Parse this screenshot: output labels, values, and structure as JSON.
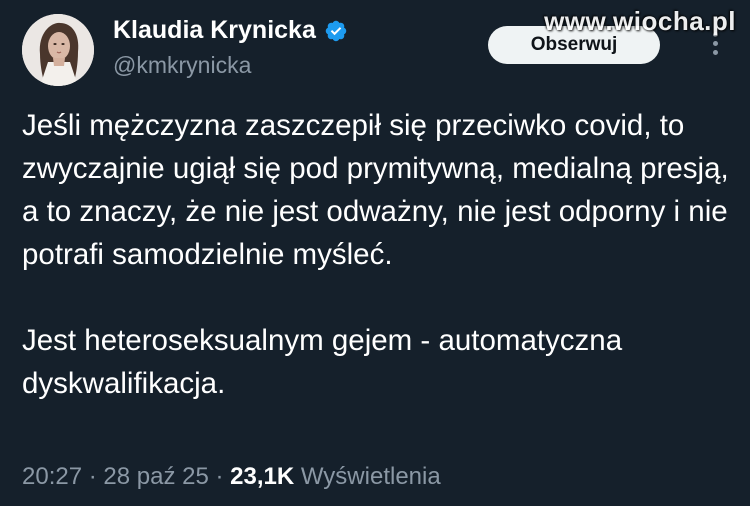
{
  "author": {
    "name": "Klaudia Krynicka",
    "handle": "@kmkrynicka",
    "verified_icon": "verified-badge-icon",
    "verified_color": "#1d9bf0"
  },
  "follow_button": {
    "label": "Obserwuj"
  },
  "more_icon": "more-options-icon",
  "watermark": "www.wiocha.pl",
  "tweet": {
    "paragraphs": [
      "Jeśli mężczyzna zaszczepił się przeciwko covid, to zwyczajnie ugiął się pod prymitywną, medialną presją, a to znaczy, że nie jest odważny, nie jest odporny i nie potrafi samodzielnie myśleć.",
      "Jest heteroseksualnym gejem - automatyczna dyskwalifikacja."
    ]
  },
  "meta": {
    "time": "20:27",
    "separator": " · ",
    "date": "28 paź 25",
    "views_count": "23,1K",
    "views_label": "Wyświetlenia"
  },
  "colors": {
    "background": "#15202b",
    "text": "#ffffff",
    "secondary_text": "#8b98a5",
    "button_bg": "#eff3f4"
  }
}
